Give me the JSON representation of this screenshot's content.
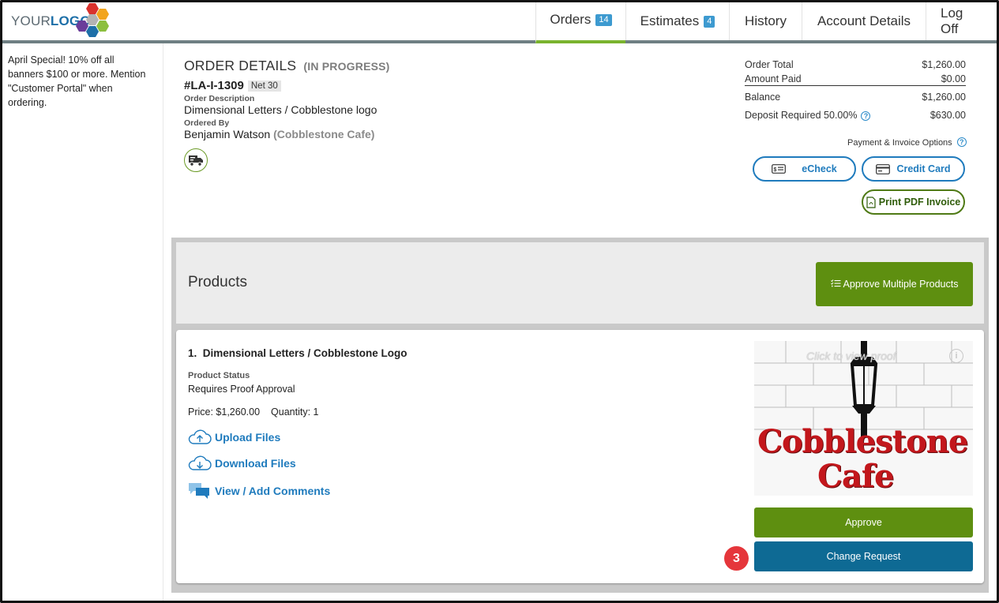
{
  "header": {
    "logo_prefix": "YOUR",
    "logo_suffix": "LOGO",
    "nav": [
      {
        "label": "Orders",
        "badge": "14"
      },
      {
        "label": "Estimates",
        "badge": "4"
      },
      {
        "label": "History"
      },
      {
        "label": "Account Details"
      },
      {
        "label": "Log Off"
      }
    ]
  },
  "promo": {
    "text": "April Special! 10% off all banners $100 or more. Mention \"Customer Portal\" when ordering."
  },
  "order": {
    "title": "ORDER DETAILS",
    "status": "(IN PROGRESS)",
    "number": "#LA-I-1309",
    "terms": "Net 30",
    "description_label": "Order Description",
    "description": "Dimensional Letters / Cobblestone logo",
    "ordered_by_label": "Ordered By",
    "ordered_by": "Benjamin Watson",
    "company": "(Cobblestone Cafe)"
  },
  "totals": {
    "order_total_label": "Order Total",
    "order_total": "$1,260.00",
    "amount_paid_label": "Amount Paid",
    "amount_paid": "$0.00",
    "balance_label": "Balance",
    "balance": "$1,260.00",
    "deposit_label": "Deposit Required 50.00%",
    "deposit": "$630.00",
    "payment_options_label": "Payment & Invoice Options",
    "echeck_label": "eCheck",
    "credit_card_label": "Credit Card",
    "print_invoice_label": "Print PDF Invoice"
  },
  "products": {
    "title": "Products",
    "approve_multiple_label": "Approve Multiple Products",
    "item": {
      "name": "1.  Dimensional Letters / Cobblestone Logo",
      "status_label": "Product Status",
      "status": "Requires Proof Approval",
      "price": "Price: $1,260.00",
      "quantity": "Quantity: 1",
      "upload_label": "Upload Files",
      "download_label": "Download Files",
      "comments_label": "View / Add Comments",
      "proof_hint": "Click to view proof",
      "proof_line1": "Cobblestone",
      "proof_line2": "Cafe",
      "approve_label": "Approve",
      "change_request_label": "Change Request"
    }
  },
  "callout_step": "3",
  "colors": {
    "accent_green": "#5e8f10",
    "accent_blue": "#1f7bbd",
    "change_request_blue": "#0e6a94",
    "callout_red": "#e5363b"
  }
}
